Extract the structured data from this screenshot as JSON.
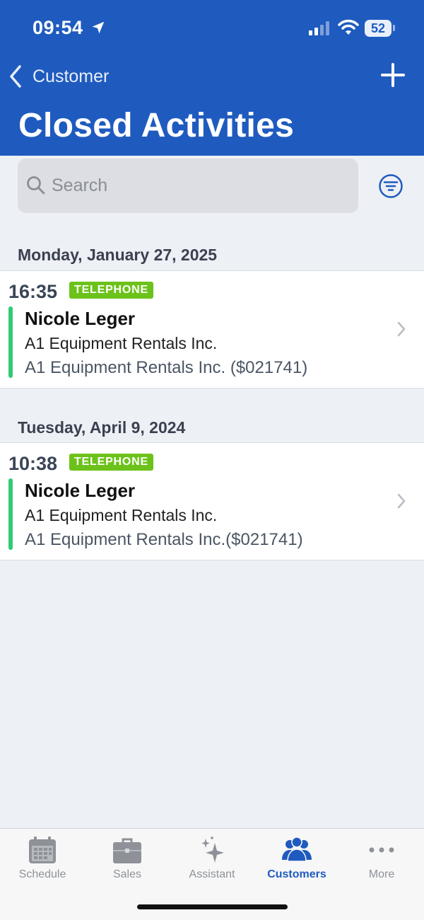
{
  "status_bar": {
    "time": "09:54",
    "battery": "52"
  },
  "nav": {
    "back_label": "Customer",
    "title": "Closed Activities"
  },
  "search": {
    "placeholder": "Search"
  },
  "sections": [
    {
      "date": "Monday, January 27, 2025",
      "activity": {
        "time": "16:35",
        "type": "TELEPHONE",
        "contact": "Nicole Leger",
        "company": "A1 Equipment Rentals Inc.",
        "account": "A1 Equipment Rentals Inc. ($021741)"
      }
    },
    {
      "date": "Tuesday, April 9, 2024",
      "activity": {
        "time": "10:38",
        "type": "TELEPHONE",
        "contact": "Nicole Leger",
        "company": "A1 Equipment Rentals Inc.",
        "account": "A1 Equipment Rentals Inc.($021741)"
      }
    }
  ],
  "tabbar": {
    "tabs": [
      {
        "label": "Schedule",
        "icon": "calendar-icon",
        "active": false
      },
      {
        "label": "Sales",
        "icon": "briefcase-icon",
        "active": false
      },
      {
        "label": "Assistant",
        "icon": "sparkles-icon",
        "active": false
      },
      {
        "label": "Customers",
        "icon": "people-icon",
        "active": true
      },
      {
        "label": "More",
        "icon": "ellipsis-icon",
        "active": false
      }
    ]
  },
  "colors": {
    "header_bg": "#1f5bbf",
    "badge": "#6cc21a",
    "accent_bar": "#2fcc73",
    "active_tab": "#1f5bbf",
    "page_bg": "#edf0f5"
  }
}
